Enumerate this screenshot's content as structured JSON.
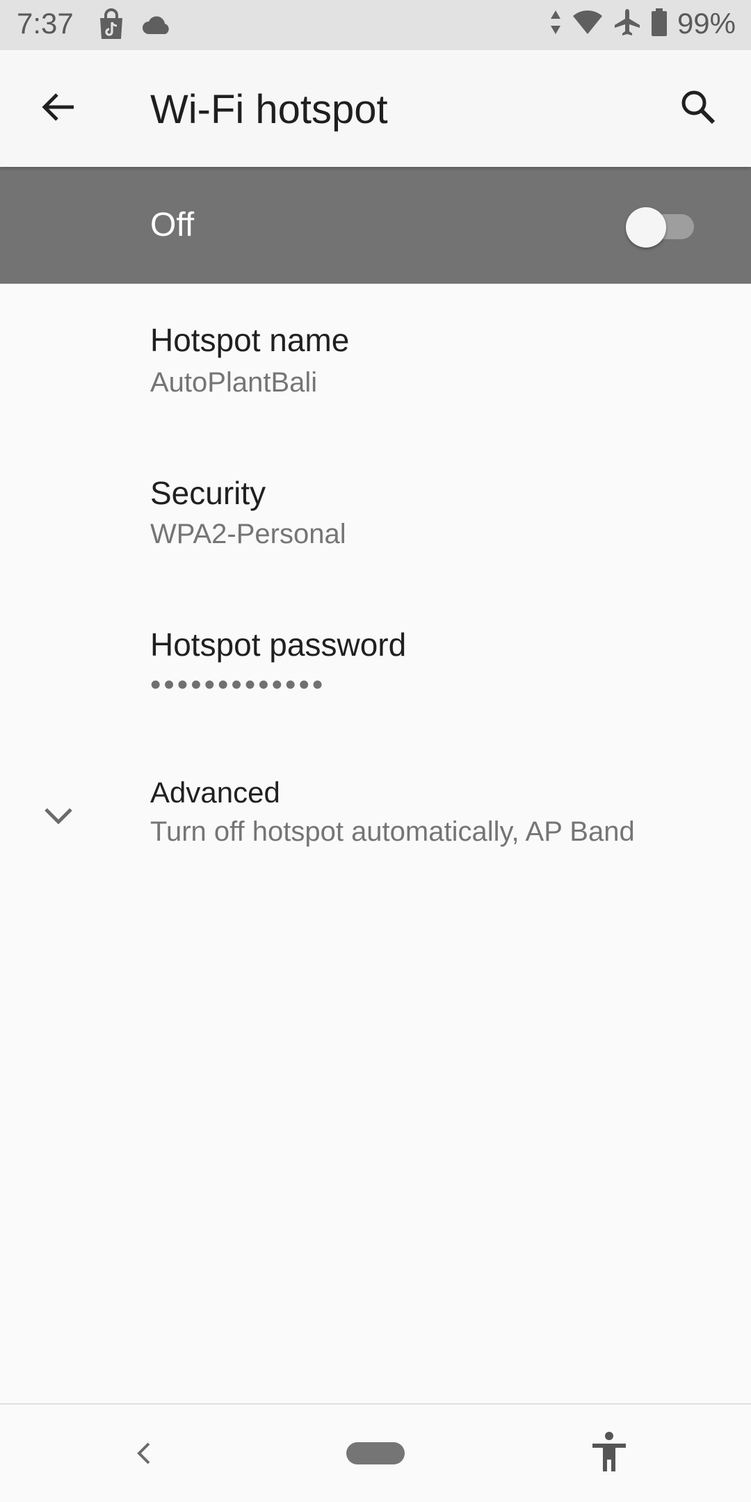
{
  "status_bar": {
    "time": "7:37",
    "left_icons": [
      "tiktok-shop-icon",
      "cloud-icon"
    ],
    "right_icons": [
      "data-arrows-icon",
      "wifi-icon",
      "airplane-icon",
      "battery-icon"
    ],
    "battery_percent": "99%"
  },
  "app_bar": {
    "title": "Wi-Fi hotspot",
    "back_icon": "arrow-back-icon",
    "search_icon": "search-icon"
  },
  "master_switch": {
    "label": "Off",
    "checked": false,
    "bar_color": "#737373"
  },
  "preferences": {
    "hotspot_name": {
      "title": "Hotspot name",
      "summary": "AutoPlantBali"
    },
    "security": {
      "title": "Security",
      "summary": "WPA2-Personal"
    },
    "password": {
      "title": "Hotspot password",
      "summary": "•••••••••••••"
    },
    "advanced": {
      "title": "Advanced",
      "summary": "Turn off hotspot automatically, AP Band",
      "icon": "chevron-down-icon"
    }
  },
  "nav_bar": {
    "back_icon": "nav-back-icon",
    "home_icon": "home-pill-icon",
    "accessibility_icon": "accessibility-icon"
  }
}
